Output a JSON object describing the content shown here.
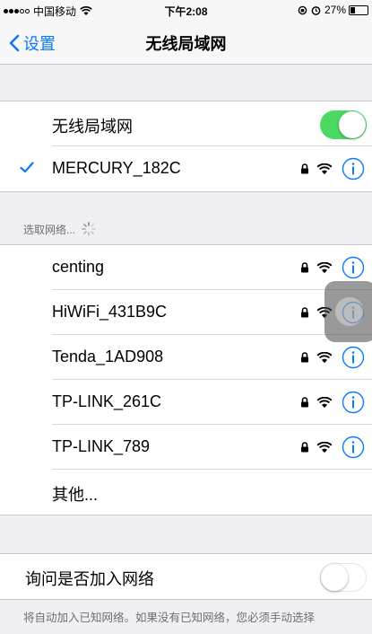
{
  "status_bar": {
    "carrier": "中国移动",
    "time": "下午2:08",
    "battery": "27%",
    "battery_level": 0.27
  },
  "nav": {
    "back_label": "设置",
    "title": "无线局域网"
  },
  "wifi_toggle": {
    "label": "无线局域网",
    "on": true
  },
  "connected_network": {
    "name": "MERCURY_182C",
    "secured": true
  },
  "choose_network": {
    "header": "选取网络..."
  },
  "networks": [
    {
      "name": "centing",
      "secured": true
    },
    {
      "name": "HiWiFi_431B9C",
      "secured": true
    },
    {
      "name": "Tenda_1AD908",
      "secured": true
    },
    {
      "name": "TP-LINK_261C",
      "secured": true
    },
    {
      "name": "TP-LINK_789",
      "secured": true
    }
  ],
  "other_label": "其他...",
  "ask_to_join": {
    "label": "询问是否加入网络",
    "on": false
  },
  "footer_text": "将自动加入已知网络。如果没有已知网络，您必须手动选择",
  "colors": {
    "accent": "#0a7aff",
    "toggle_on": "#4cd964",
    "background": "#efeff4"
  },
  "icons": [
    "lock-icon",
    "wifi-icon",
    "info-icon",
    "checkmark-icon",
    "chevron-left-icon",
    "spinner-icon"
  ]
}
